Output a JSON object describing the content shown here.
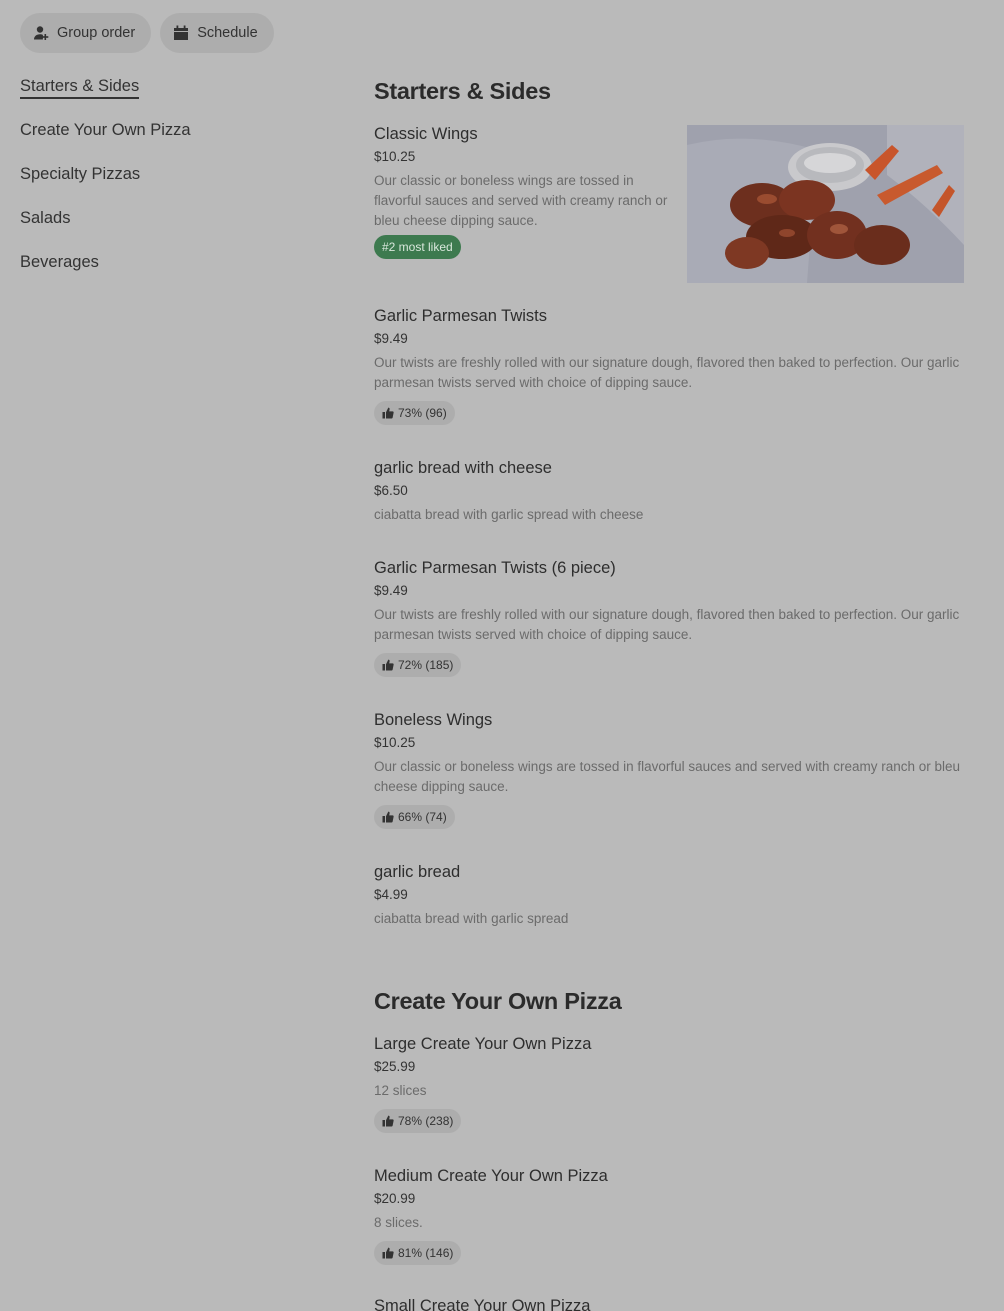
{
  "topbar": {
    "group_order": {
      "label": "Group order",
      "icon": "person-add-icon"
    },
    "schedule": {
      "label": "Schedule",
      "icon": "calendar-icon"
    }
  },
  "sidenav": {
    "items": [
      {
        "label": "Starters & Sides",
        "active": true
      },
      {
        "label": "Create Your Own Pizza"
      },
      {
        "label": "Specialty Pizzas"
      },
      {
        "label": "Salads"
      },
      {
        "label": "Beverages"
      }
    ]
  },
  "sections": [
    {
      "title": "Starters & Sides",
      "items": [
        {
          "name": "Classic Wings",
          "price": "$10.25",
          "description": "Our classic or boneless wings are tossed in flavorful sauces and served with creamy ranch or bleu cheese dipping sauce.",
          "badge": "#2 most liked",
          "image": "chicken-wings-photo"
        },
        {
          "name": "Garlic Parmesan Twists",
          "price": "$9.49",
          "description": "Our twists are freshly rolled with our signature dough, flavored then baked to perfection. Our garlic parmesan twists served with choice of dipping sauce.",
          "rating": "73% (96)"
        },
        {
          "name": "garlic bread with cheese",
          "price": "$6.50",
          "description": "ciabatta bread with garlic spread with cheese"
        },
        {
          "name": "Garlic Parmesan Twists (6 piece)",
          "price": "$9.49",
          "description": "Our twists are freshly rolled with our signature dough, flavored then baked to perfection. Our garlic parmesan twists served with choice of dipping sauce.",
          "rating": "72% (185)"
        },
        {
          "name": "Boneless Wings",
          "price": "$10.25",
          "description": "Our classic or boneless wings are tossed in flavorful sauces and served with creamy ranch or bleu cheese dipping sauce.",
          "rating": "66% (74)"
        },
        {
          "name": "garlic bread",
          "price": "$4.99",
          "description": "ciabatta bread with garlic spread"
        }
      ]
    },
    {
      "title": "Create Your Own Pizza",
      "items": [
        {
          "name": "Large Create Your Own Pizza",
          "price": "$25.99",
          "description": "12 slices",
          "rating": "78% (238)"
        },
        {
          "name": "Medium Create Your Own Pizza",
          "price": "$20.99",
          "description": "8 slices.",
          "rating": "81% (146)"
        },
        {
          "name": "Small Create Your Own Pizza"
        }
      ]
    }
  ]
}
